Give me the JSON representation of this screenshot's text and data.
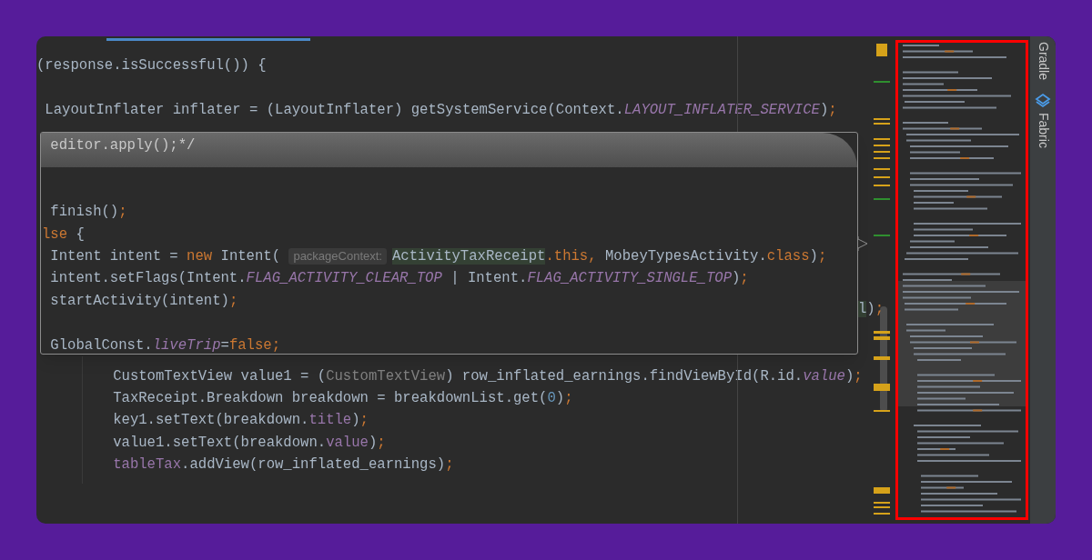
{
  "editor": {
    "lines_above": [
      {
        "kind": "code",
        "segments": [
          {
            "kind": "plain",
            "text": "(response.isSuccessful()) {"
          }
        ]
      },
      {
        "kind": "blank"
      },
      {
        "kind": "code",
        "segments": [
          {
            "kind": "plain",
            "text": " LayoutInflater inflater = (LayoutInflater) getSystemService(Context."
          },
          {
            "kind": "field",
            "text": "LAYOUT_INFLATER_SERVICE"
          },
          {
            "kind": "plain",
            "text": ")"
          },
          {
            "kind": "keyword",
            "text": ";"
          }
        ]
      }
    ],
    "behind_popup": [
      {
        "kind": "match",
        "text": "l"
      },
      {
        "kind": "plain",
        "text": ")"
      },
      {
        "kind": "keyword",
        "text": ";"
      }
    ],
    "lines_below": [
      {
        "kind": "code",
        "segments": [
          {
            "kind": "plain",
            "text": "CustomTextView value1 = ("
          },
          {
            "kind": "cast",
            "text": "CustomTextView"
          },
          {
            "kind": "plain",
            "text": ") row_inflated_earnings.findViewById(R.id."
          },
          {
            "kind": "field",
            "text": "value"
          },
          {
            "kind": "plain",
            "text": ")"
          },
          {
            "kind": "keyword",
            "text": ";"
          }
        ]
      },
      {
        "kind": "code",
        "segments": [
          {
            "kind": "plain",
            "text": "TaxReceipt.Breakdown breakdown = breakdownList.get("
          },
          {
            "kind": "number",
            "text": "0"
          },
          {
            "kind": "plain",
            "text": ")"
          },
          {
            "kind": "keyword",
            "text": ";"
          }
        ]
      },
      {
        "kind": "code",
        "segments": [
          {
            "kind": "plain",
            "text": "key1.setText(breakdown."
          },
          {
            "kind": "member",
            "text": "title"
          },
          {
            "kind": "plain",
            "text": ")"
          },
          {
            "kind": "keyword",
            "text": ";"
          }
        ]
      },
      {
        "kind": "code",
        "segments": [
          {
            "kind": "plain",
            "text": "value1.setText(breakdown."
          },
          {
            "kind": "member",
            "text": "value"
          },
          {
            "kind": "plain",
            "text": ")"
          },
          {
            "kind": "keyword",
            "text": ";"
          }
        ]
      },
      {
        "kind": "code",
        "segments": [
          {
            "kind": "member",
            "text": "tableTax"
          },
          {
            "kind": "plain",
            "text": ".addView(row_inflated_earnings)"
          },
          {
            "kind": "keyword",
            "text": ";"
          }
        ]
      }
    ]
  },
  "popup": {
    "header": {
      "kind": "code",
      "segments": [
        {
          "kind": "plain",
          "text": " editor.apply();*/"
        }
      ]
    },
    "lines": [
      {
        "kind": "blank"
      },
      {
        "kind": "blank"
      },
      {
        "kind": "code",
        "segments": [
          {
            "kind": "plain",
            "text": " finish()"
          },
          {
            "kind": "keyword",
            "text": ";"
          }
        ]
      },
      {
        "kind": "code",
        "segments": [
          {
            "kind": "keyword",
            "text": "lse "
          },
          {
            "kind": "plain",
            "text": "{"
          }
        ]
      },
      {
        "kind": "code",
        "segments": [
          {
            "kind": "plain",
            "text": " Intent intent = "
          },
          {
            "kind": "keyword",
            "text": "new "
          },
          {
            "kind": "plain",
            "text": "Intent( "
          },
          {
            "kind": "hint",
            "text": "packageContext:"
          },
          {
            "kind": "match",
            "text": "ActivityTaxReceipt"
          },
          {
            "kind": "keyword",
            "text": ".this, "
          },
          {
            "kind": "plain",
            "text": "MobeyTypesActivity."
          },
          {
            "kind": "keyword",
            "text": "class"
          },
          {
            "kind": "plain",
            "text": ")"
          },
          {
            "kind": "keyword",
            "text": ";"
          }
        ]
      },
      {
        "kind": "code",
        "segments": [
          {
            "kind": "plain",
            "text": " intent.setFlags(Intent."
          },
          {
            "kind": "field",
            "text": "FLAG_ACTIVITY_CLEAR_TOP"
          },
          {
            "kind": "plain",
            "text": " | Intent."
          },
          {
            "kind": "field",
            "text": "FLAG_ACTIVITY_SINGLE_TOP"
          },
          {
            "kind": "plain",
            "text": ")"
          },
          {
            "kind": "keyword",
            "text": ";"
          }
        ]
      },
      {
        "kind": "code",
        "segments": [
          {
            "kind": "plain",
            "text": " startActivity(intent)"
          },
          {
            "kind": "keyword",
            "text": ";"
          }
        ]
      },
      {
        "kind": "blank"
      },
      {
        "kind": "code",
        "segments": [
          {
            "kind": "plain",
            "text": " GlobalConst."
          },
          {
            "kind": "field",
            "text": "liveTrip"
          },
          {
            "kind": "plain",
            "text": "="
          },
          {
            "kind": "keyword",
            "text": "false;"
          }
        ]
      }
    ]
  },
  "tool_windows": [
    {
      "kind": "text",
      "label": "Gradle"
    },
    {
      "kind": "icon",
      "label": "Fabric"
    }
  ]
}
